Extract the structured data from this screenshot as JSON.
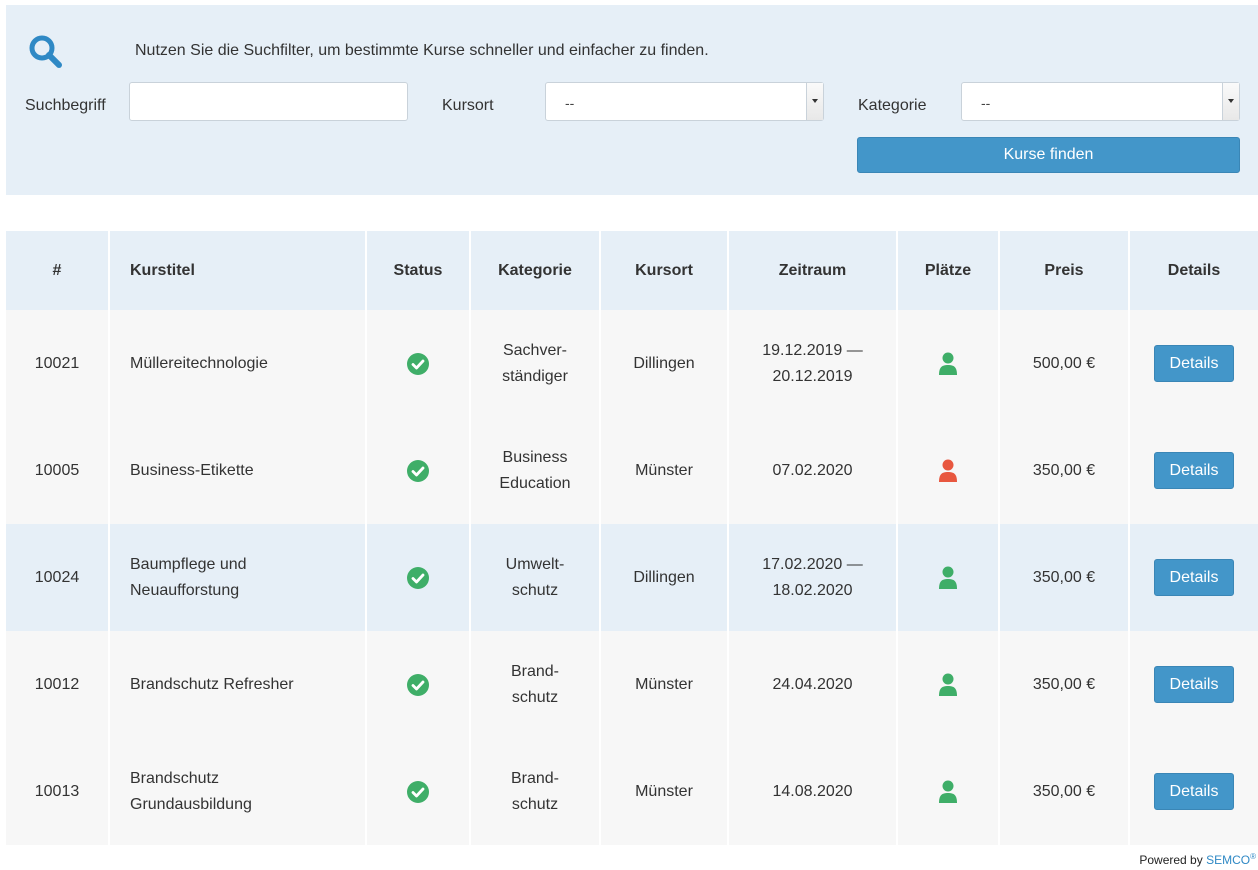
{
  "search": {
    "hint": "Nutzen Sie die Suchfilter, um bestimmte Kurse schneller und einfacher zu finden.",
    "term_label": "Suchbegriff",
    "term_value": "",
    "location_label": "Kursort",
    "location_selected": "--",
    "category_label": "Kategorie",
    "category_selected": "--",
    "submit_label": "Kurse finden",
    "icon": "search-icon"
  },
  "table": {
    "headers": {
      "id": "#",
      "title": "Kurstitel",
      "status": "Status",
      "category": "Kategorie",
      "location": "Kursort",
      "period": "Zeitraum",
      "seats": "Plätze",
      "price": "Preis",
      "details": "Details"
    },
    "rows": [
      {
        "id": "10021",
        "title": "Müllereitechnologie",
        "category": "Sachver-\nständiger",
        "location": "Dillingen",
        "period": "19.12.2019 —\n20.12.2019",
        "seats_available": true,
        "price": "500,00 €",
        "details_label": "Details"
      },
      {
        "id": "10005",
        "title": "Business-Etikette",
        "category": "Business\nEducation",
        "location": "Münster",
        "period": "07.02.2020",
        "seats_available": false,
        "price": "350,00 €",
        "details_label": "Details"
      },
      {
        "id": "10024",
        "title": "Baumpflege und\nNeuaufforstung",
        "category": "Umwelt-\nschutz",
        "location": "Dillingen",
        "period": "17.02.2020 —\n18.02.2020",
        "seats_available": true,
        "price": "350,00 €",
        "details_label": "Details"
      },
      {
        "id": "10012",
        "title": "Brandschutz Refresher",
        "category": "Brand-\nschutz",
        "location": "Münster",
        "period": "24.04.2020",
        "seats_available": true,
        "price": "350,00 €",
        "details_label": "Details"
      },
      {
        "id": "10013",
        "title": "Brandschutz\nGrundausbildung",
        "category": "Brand-\nschutz",
        "location": "Münster",
        "period": "14.08.2020",
        "seats_available": true,
        "price": "350,00 €",
        "details_label": "Details"
      }
    ]
  },
  "footer": {
    "powered_by": "Powered by",
    "brand": "SEMCO",
    "brand_mark": "®"
  },
  "colors": {
    "accent": "#4396c9",
    "panel_bg": "#e6eff7",
    "status_ok": "#3fae68",
    "seats_available": "#3fae68",
    "seats_full": "#e8573f"
  }
}
